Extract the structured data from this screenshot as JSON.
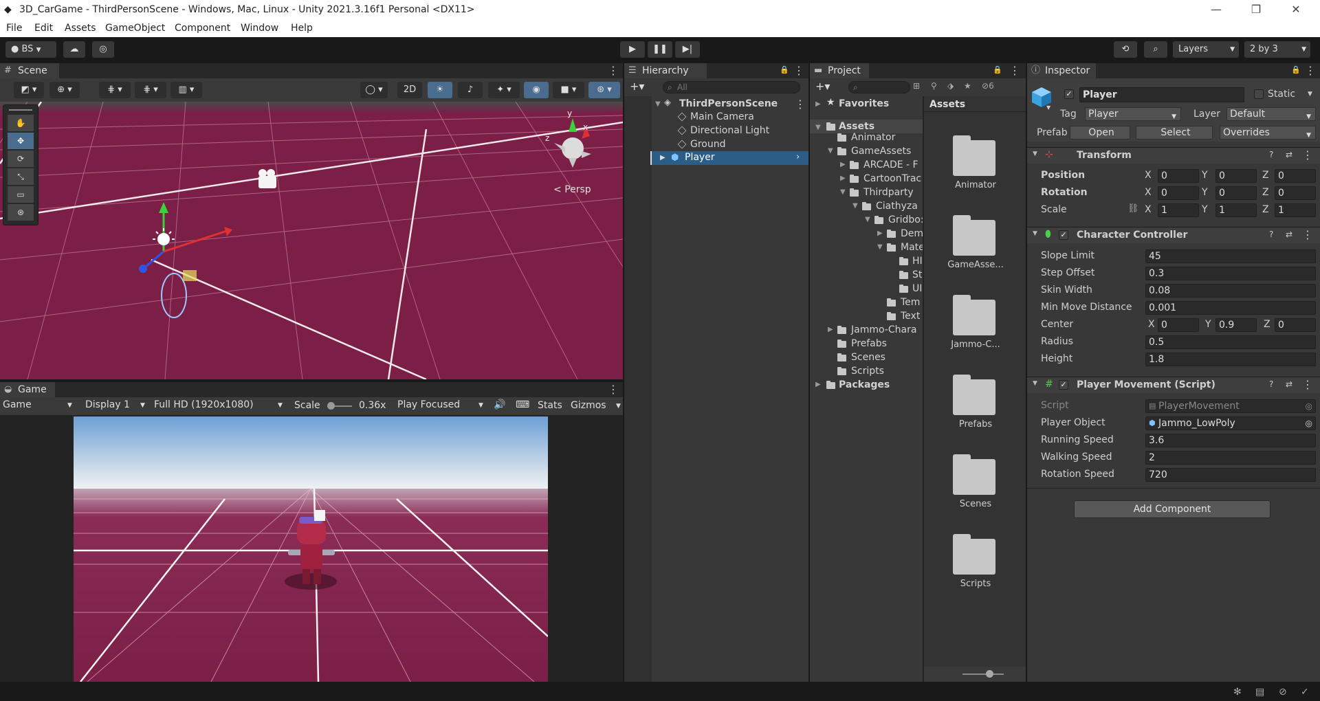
{
  "window": {
    "title": "3D_CarGame - ThirdPersonScene - Windows, Mac, Linux - Unity 2021.3.16f1 Personal <DX11>"
  },
  "menu": [
    "File",
    "Edit",
    "Assets",
    "GameObject",
    "Component",
    "Window",
    "Help"
  ],
  "toolbar": {
    "account": "BS",
    "layers": "Layers",
    "layout": "2 by 3"
  },
  "scene": {
    "tab": "Scene",
    "btn_2d": "2D",
    "persp": "Persp",
    "axis_x": "x",
    "axis_y": "y",
    "axis_z": "z"
  },
  "game": {
    "tab": "Game",
    "mode": "Game",
    "display": "Display 1",
    "resolution": "Full HD (1920x1080)",
    "scale_label": "Scale",
    "scale_value": "0.36x",
    "play_mode": "Play Focused",
    "stats": "Stats",
    "gizmos": "Gizmos"
  },
  "hierarchy": {
    "tab": "Hierarchy",
    "search_placeholder": "All",
    "scene": "ThirdPersonScene",
    "items": [
      "Main Camera",
      "Directional Light",
      "Ground",
      "Player"
    ]
  },
  "project": {
    "tab": "Project",
    "hidden_count": "6",
    "favorites": "Favorites",
    "tree": [
      {
        "label": "Assets"
      },
      {
        "label": "Animator"
      },
      {
        "label": "GameAssets"
      },
      {
        "label": "ARCADE - F"
      },
      {
        "label": "CartoonTrac"
      },
      {
        "label": "Thirdparty"
      },
      {
        "label": "Ciathyza"
      },
      {
        "label": "Gridbo:"
      },
      {
        "label": "Dem"
      },
      {
        "label": "Mate"
      },
      {
        "label": "HI"
      },
      {
        "label": "St"
      },
      {
        "label": "UI"
      },
      {
        "label": "Tem"
      },
      {
        "label": "Text"
      },
      {
        "label": "Jammo-Chara"
      },
      {
        "label": "Prefabs"
      },
      {
        "label": "Scenes"
      },
      {
        "label": "Scripts"
      },
      {
        "label": "Packages"
      }
    ],
    "assets_header": "Assets",
    "grid": [
      "Animator",
      "GameAsse...",
      "Jammo-C...",
      "Prefabs",
      "Scenes",
      "Scripts"
    ]
  },
  "inspector": {
    "tab": "Inspector",
    "object_name": "Player",
    "static_label": "Static",
    "tag_label": "Tag",
    "tag_value": "Player",
    "layer_label": "Layer",
    "layer_value": "Default",
    "prefab_label": "Prefab",
    "prefab_open": "Open",
    "prefab_select": "Select",
    "prefab_overrides": "Overrides",
    "transform": {
      "title": "Transform",
      "position_label": "Position",
      "rotation_label": "Rotation",
      "scale_label": "Scale",
      "position": [
        "0",
        "0",
        "0"
      ],
      "rotation": [
        "0",
        "0",
        "0"
      ],
      "scale": [
        "1",
        "1",
        "1"
      ]
    },
    "cc": {
      "title": "Character Controller",
      "slope_limit_label": "Slope Limit",
      "slope_limit": "45",
      "step_offset_label": "Step Offset",
      "step_offset": "0.3",
      "skin_width_label": "Skin Width",
      "skin_width": "0.08",
      "min_move_label": "Min Move Distance",
      "min_move": "0.001",
      "center_label": "Center",
      "center": [
        "0",
        "0.9",
        "0"
      ],
      "radius_label": "Radius",
      "radius": "0.5",
      "height_label": "Height",
      "height": "1.8"
    },
    "pm": {
      "title": "Player Movement (Script)",
      "script_label": "Script",
      "script": "PlayerMovement",
      "player_object_label": "Player Object",
      "player_object": "Jammo_LowPoly",
      "running_label": "Running Speed",
      "running": "3.6",
      "walking_label": "Walking Speed",
      "walking": "2",
      "rotation_label": "Rotation Speed",
      "rotation": "720"
    },
    "add_component": "Add Component"
  },
  "colors": {
    "ground": "#7b1f47",
    "accent": "#2c5d87",
    "panel": "#383838"
  }
}
